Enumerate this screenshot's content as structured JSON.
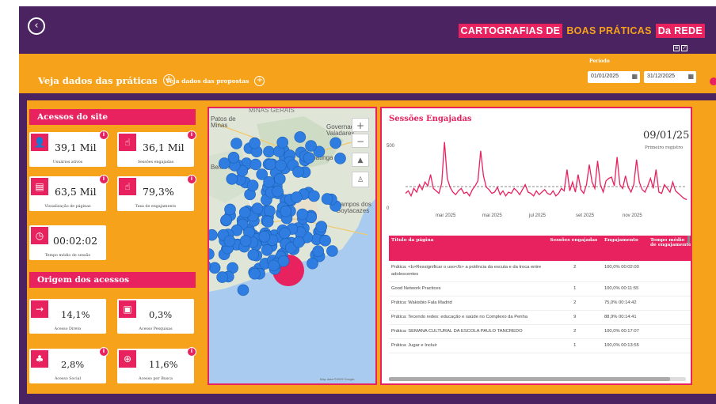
{
  "header": {
    "back_icon": "circle-chevron-left-icon",
    "brand": {
      "part1": "CARTOGRAFIAS DE",
      "part2": "BOAS PRÁTICAS",
      "part3": "Da REDE"
    }
  },
  "filters": {
    "tab_practices": "Veja dados das práticas",
    "tab_proposals": "Veja dados das propostas",
    "period_label": "Período",
    "date_start": "01/01/2025",
    "date_end": "31/12/2025"
  },
  "site_access": {
    "title": "Acessos do site",
    "cards": [
      {
        "icon": "user-icon",
        "value": "39,1 Mil",
        "label": "Usuários ativos"
      },
      {
        "icon": "click-icon",
        "value": "36,1 Mil",
        "label": "Sessões engajadas"
      },
      {
        "icon": "pageview-icon",
        "value": "63,5 Mil",
        "label": "Visualização de páginas"
      },
      {
        "icon": "click-icon",
        "value": "79,3%",
        "label": "Taxa de engajamento"
      },
      {
        "icon": "clock-icon",
        "value": "00:02:02",
        "label": "Tempo médio de sessão"
      }
    ]
  },
  "origins": {
    "title": "Origem dos acessos",
    "cards": [
      {
        "icon": "arrow-right-icon",
        "value": "14,1%",
        "label": "Acesso Direto"
      },
      {
        "icon": "ad-icon",
        "value": "0,3%",
        "label": "Acesso Pesquisas"
      },
      {
        "icon": "social-icon",
        "value": "2,8%",
        "label": "Acesso Social"
      },
      {
        "icon": "globe-icon",
        "value": "11,6%",
        "label": "Acesso por Busca"
      }
    ]
  },
  "map": {
    "labels": {
      "minas": "MINAS GERAIS",
      "patos": "Patos de Minas",
      "belo": "Belo Horizonte",
      "vitoria": "Vitória",
      "governador": "Governador Valadares",
      "ipatinga": "Ipatinga",
      "campos": "Campos dos Goytacazes",
      "rio": "Rio"
    },
    "attribution": "Map data ©2025 Google"
  },
  "sessions": {
    "title": "Sessões Engajadas",
    "highlight_date": "09/01/25",
    "highlight_label": "Primeiro registro"
  },
  "chart_data": {
    "type": "line",
    "title": "Sessões Engajadas",
    "x_ticks": [
      "mar 2025",
      "mai 2025",
      "jul 2025",
      "set 2025",
      "nov 2025"
    ],
    "y_ticks": [
      0,
      500
    ],
    "ylim": [
      0,
      600
    ],
    "series": [
      {
        "values": [
          110,
          130,
          90,
          150,
          120,
          180,
          140,
          200,
          170,
          260,
          150,
          130,
          110,
          190,
          520,
          230,
          160,
          120,
          100,
          130,
          150,
          110,
          120,
          90,
          140,
          170,
          210,
          450,
          250,
          160,
          140,
          110,
          120,
          160,
          100,
          130,
          90,
          120,
          110,
          150,
          130,
          100,
          140,
          180,
          120,
          110,
          90,
          130,
          100,
          120,
          140,
          110,
          100,
          130,
          90,
          110,
          150,
          130,
          300,
          130,
          200,
          120,
          260,
          140,
          110,
          180,
          340,
          200,
          150,
          370,
          180,
          120,
          210,
          230,
          240,
          170,
          400,
          180,
          150,
          250,
          160,
          120,
          180,
          380,
          200,
          140,
          120,
          170,
          230,
          150,
          300,
          120,
          110,
          180,
          150,
          120,
          200,
          130,
          110,
          90,
          70,
          60
        ]
      }
    ]
  },
  "pages_table": {
    "headers": [
      "Título da página",
      "Sessões engajadas",
      "Engajamento",
      "Tempo médio de engajamento"
    ],
    "rows": [
      [
        "Prática: <b>Ressignificar o uso</b> a potência da escuta e da troca entre adolescentes",
        "2",
        "100,0%",
        "00:02:00"
      ],
      [
        "Good Network Practices",
        "1",
        "100,0%",
        "00:11:55"
      ],
      [
        "Prática: Wakisbio Fala Madrid",
        "2",
        "75,0%",
        "00:14:42"
      ],
      [
        "Prática: Tecendo redes: educação e saúde no Complexo da Penha",
        "9",
        "88,9%",
        "00:14:41"
      ],
      [
        "Prática: SEMANA CULTURAL DA ESCOLA PAULO TANCREDO",
        "2",
        "100,0%",
        "00:17:07"
      ],
      [
        "Prática: Jugar e Incluir",
        "1",
        "100,0%",
        "00:13:55"
      ]
    ]
  }
}
